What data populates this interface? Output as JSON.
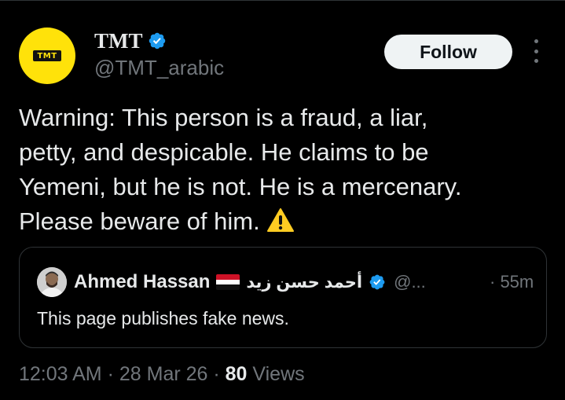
{
  "author": {
    "name": "TMT",
    "handle": "@TMT_arabic",
    "avatar_logo": "TMT",
    "verified_icon": "verified-badge-icon",
    "avatar_color": "#ffe20a"
  },
  "actions": {
    "follow_label": "Follow",
    "more_icon": "more-options-icon"
  },
  "tweet": {
    "lines": [
      "Warning: This person is a fraud, a liar,",
      "petty, and despicable. He claims to be",
      "Yemeni, but he is not. He is a mercenary.",
      "Please beware of him."
    ],
    "emoji_icon": "warning-icon"
  },
  "quote": {
    "name": "Ahmed Hassan",
    "flag_icon": "yemen-flag-icon",
    "arabic_name": "أحمد حسن زيد",
    "verified_icon": "verified-badge-icon",
    "handle": "@...",
    "time": "· 55m",
    "text": "This page publishes fake news."
  },
  "meta": {
    "time": "12:03 AM",
    "sep1": " · ",
    "date": "28 Mar 26",
    "sep2": " · ",
    "views_count": "80",
    "views_label": " Views"
  },
  "colors": {
    "background": "#000000",
    "text": "#e7e9ea",
    "secondary": "#71767b",
    "verified": "#1d9bf0",
    "border": "#2f3336"
  }
}
